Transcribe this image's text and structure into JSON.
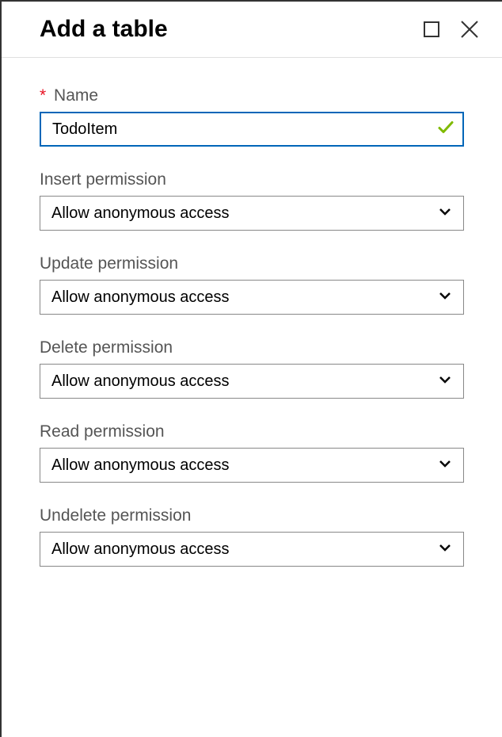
{
  "header": {
    "title": "Add a table"
  },
  "form": {
    "name": {
      "label": "Name",
      "value": "TodoItem",
      "required": true
    },
    "permissions": [
      {
        "label": "Insert permission",
        "value": "Allow anonymous access"
      },
      {
        "label": "Update permission",
        "value": "Allow anonymous access"
      },
      {
        "label": "Delete permission",
        "value": "Allow anonymous access"
      },
      {
        "label": "Read permission",
        "value": "Allow anonymous access"
      },
      {
        "label": "Undelete permission",
        "value": "Allow anonymous access"
      }
    ]
  }
}
